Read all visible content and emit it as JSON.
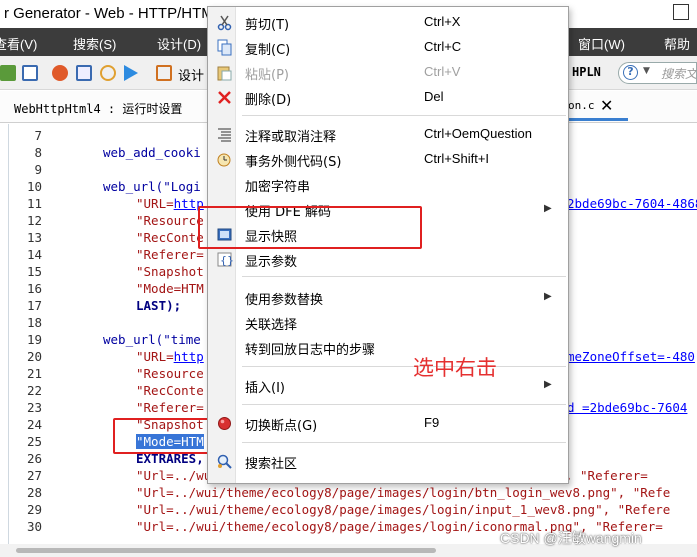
{
  "window": {
    "title": "r Generator - Web - HTTP/HTM"
  },
  "menubar": {
    "items": [
      "查看(V)",
      "搜索(S)",
      "设计(D)",
      "窗口(W)",
      "帮助"
    ]
  },
  "toolbar": {
    "design_label": "设计",
    "hpln_label": "HPLN",
    "search_placeholder": "搜索文"
  },
  "tabs": {
    "active": "WebHttpHtml4 : 运行时设置",
    "right_tab": "on.c"
  },
  "editor": {
    "lines": [
      {
        "n": "7",
        "code": ""
      },
      {
        "n": "8",
        "code": "web_add_cooki"
      },
      {
        "n": "9",
        "code": ""
      },
      {
        "n": "10",
        "code": "web_url(\"Logi"
      },
      {
        "n": "11",
        "pre": "\"URL=",
        "link": "http"
      },
      {
        "n": "12",
        "code": "\"Resource"
      },
      {
        "n": "13",
        "code": "\"RecConte"
      },
      {
        "n": "14",
        "code": "\"Referer="
      },
      {
        "n": "15",
        "code": "\"Snapshot"
      },
      {
        "n": "16",
        "code": "\"Mode=HTM"
      },
      {
        "n": "17",
        "code": "LAST);"
      },
      {
        "n": "18",
        "code": ""
      },
      {
        "n": "19",
        "code": "web_url(\"time"
      },
      {
        "n": "20",
        "pre": "\"URL=",
        "link": "http"
      },
      {
        "n": "21",
        "code": "\"Resource"
      },
      {
        "n": "22",
        "code": "\"RecConte"
      },
      {
        "n": "23",
        "code": "\"Referer="
      },
      {
        "n": "24",
        "code": "\"Snapshot"
      },
      {
        "n": "25",
        "code": "\"Mode=HTM"
      },
      {
        "n": "26",
        "code": "EXTRARES,"
      },
      {
        "n": "27",
        "code": "\"Url=../wui/theme/ecology8/page/images/login/bg_wev8.png\", \"Referer="
      },
      {
        "n": "28",
        "code": "\"Url=../wui/theme/ecology8/page/images/login/btn_login_wev8.png\", \"Refe"
      },
      {
        "n": "29",
        "code": "\"Url=../wui/theme/ecology8/page/images/login/input_1_wev8.png\", \"Refere"
      },
      {
        "n": "30",
        "code": "\"Url=../wui/theme/ecology8/page/images/login/iconormal.png\", \"Referer="
      }
    ],
    "right_fragments": {
      "r11": "2bde69bc-7604-4868",
      "r20": "meZoneOffset=-480",
      "r23": "d =2bde69bc-7604"
    }
  },
  "context_menu": {
    "items": [
      {
        "label": "剪切(T)",
        "shortcut": "Ctrl+X",
        "icon": "scissors-icon"
      },
      {
        "label": "复制(C)",
        "shortcut": "Ctrl+C",
        "icon": "copy-icon"
      },
      {
        "label": "粘贴(P)",
        "shortcut": "Ctrl+V",
        "icon": "paste-icon",
        "disabled": true
      },
      {
        "label": "删除(D)",
        "shortcut": "Del",
        "icon": "delete-icon"
      },
      {
        "label": "注释或取消注释",
        "shortcut": "Ctrl+OemQuestion",
        "icon": "comment-icon"
      },
      {
        "label": "事务外侧代码(S)",
        "shortcut": "Ctrl+Shift+I",
        "icon": "transaction-icon"
      },
      {
        "label": "加密字符串",
        "shortcut": "",
        "icon": ""
      },
      {
        "label": "使用 DFE 解码",
        "shortcut": "",
        "icon": "",
        "submenu": true
      },
      {
        "label": "显示快照",
        "shortcut": "",
        "icon": "snapshot-icon"
      },
      {
        "label": "显示参数",
        "shortcut": "",
        "icon": "parameter-icon"
      },
      {
        "label": "使用参数替换",
        "shortcut": "",
        "icon": "",
        "submenu": true
      },
      {
        "label": "关联选择",
        "shortcut": "",
        "icon": ""
      },
      {
        "label": "转到回放日志中的步骤",
        "shortcut": "",
        "icon": ""
      },
      {
        "label": "插入(I)",
        "shortcut": "",
        "icon": "",
        "submenu": true
      },
      {
        "label": "切换断点(G)",
        "shortcut": "F9",
        "icon": "breakpoint-icon"
      },
      {
        "label": "搜索社区",
        "shortcut": "",
        "icon": "community-search-icon"
      }
    ]
  },
  "annotation": {
    "text": "选中右击"
  },
  "watermark": {
    "text": "CSDN @汪敏wangmin"
  },
  "colors": {
    "menubar_bg": "#3c3c3c",
    "selection": "#3875d7",
    "annotation_red": "#e02020",
    "code_blue": "#0000a0",
    "link_blue": "#0000ff"
  }
}
